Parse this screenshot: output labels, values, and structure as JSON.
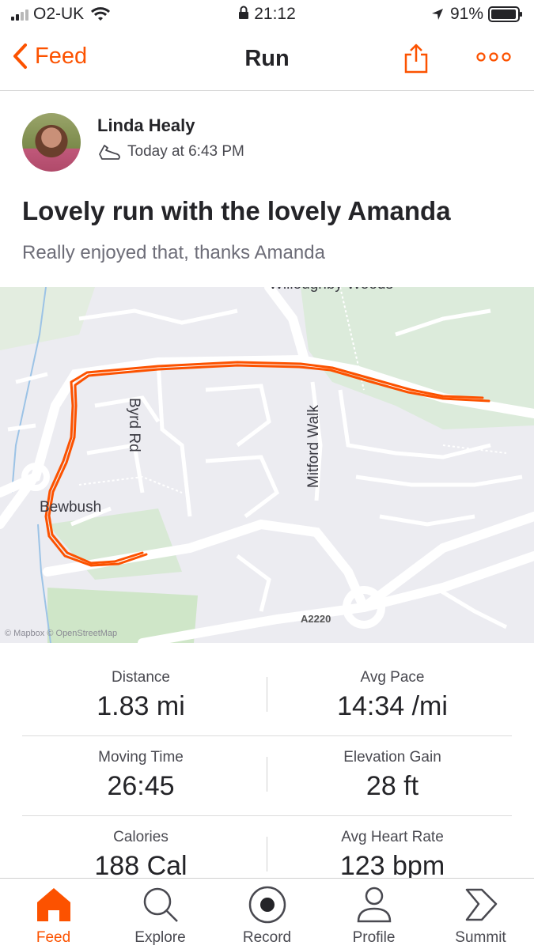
{
  "status_bar": {
    "carrier": "O2-UK",
    "time": "21:12",
    "battery": "91%"
  },
  "nav": {
    "back_label": "Feed",
    "title": "Run"
  },
  "activity": {
    "athlete_name": "Linda Healy",
    "timestamp": "Today at 6:43 PM",
    "title": "Lovely run with the lovely Amanda",
    "description": "Really enjoyed that, thanks Amanda"
  },
  "map": {
    "labels": {
      "byrd_rd": "Byrd Rd",
      "mitford_walk": "Mitford Walk",
      "bewbush": "Bewbush",
      "a2220": "A2220",
      "woods": "Willoughby Woods"
    },
    "attribution": "© Mapbox © OpenStreetMap",
    "route_color": "#fc5200"
  },
  "stats": [
    {
      "left": {
        "label": "Distance",
        "value": "1.83 mi"
      },
      "right": {
        "label": "Avg Pace",
        "value": "14:34 /mi"
      }
    },
    {
      "left": {
        "label": "Moving Time",
        "value": "26:45"
      },
      "right": {
        "label": "Elevation Gain",
        "value": "28 ft"
      }
    },
    {
      "left": {
        "label": "Calories",
        "value": "188 Cal"
      },
      "right": {
        "label": "Avg Heart Rate",
        "value": "123 bpm"
      }
    }
  ],
  "tabs": [
    {
      "label": "Feed",
      "icon": "home-icon",
      "active": true
    },
    {
      "label": "Explore",
      "icon": "search-icon"
    },
    {
      "label": "Record",
      "icon": "record-icon"
    },
    {
      "label": "Profile",
      "icon": "profile-icon"
    },
    {
      "label": "Summit",
      "icon": "summit-icon"
    }
  ],
  "colors": {
    "accent": "#fc5200",
    "text": "#242428",
    "secondary": "#6d6d78"
  }
}
